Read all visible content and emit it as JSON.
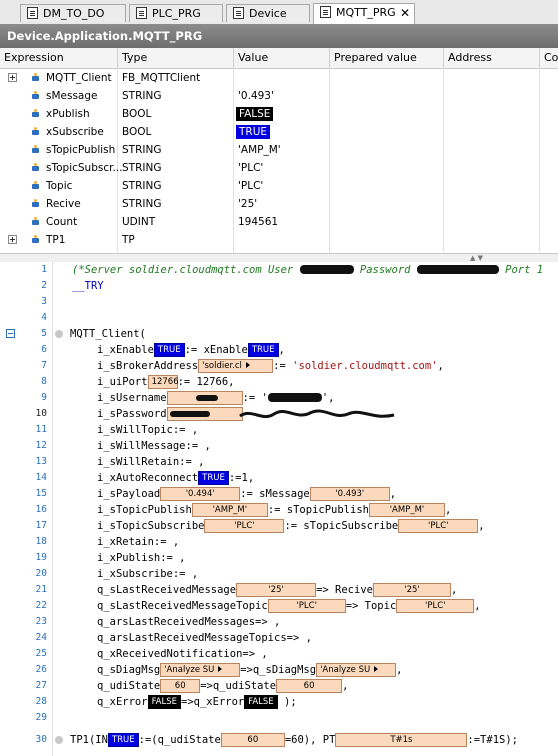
{
  "tabs": [
    {
      "label": "DM_TO_DO"
    },
    {
      "label": "PLC_PRG"
    },
    {
      "label": "Device"
    },
    {
      "label": "MQTT_PRG",
      "close": "✕"
    }
  ],
  "header": {
    "title": "Device.Application.MQTT_PRG"
  },
  "watch": {
    "columns": [
      "Expression",
      "Type",
      "Value",
      "Prepared value",
      "Address",
      "Co"
    ],
    "rows": [
      {
        "expr": "MQTT_Client",
        "type": "FB_MQTTClient",
        "value": ""
      },
      {
        "expr": "sMessage",
        "type": "STRING",
        "value": "'0.493'"
      },
      {
        "expr": "xPublish",
        "type": "BOOL",
        "value": "FALSE"
      },
      {
        "expr": "xSubscribe",
        "type": "BOOL",
        "value": "TRUE"
      },
      {
        "expr": "sTopicPublish",
        "type": "STRING",
        "value": "'AMP_M'"
      },
      {
        "expr": "sTopicSubscr...",
        "type": "STRING",
        "value": "'PLC'"
      },
      {
        "expr": "Topic",
        "type": "STRING",
        "value": "'PLC'"
      },
      {
        "expr": "Recive",
        "type": "STRING",
        "value": "'25'"
      },
      {
        "expr": "Count",
        "type": "UDINT",
        "value": "194561"
      },
      {
        "expr": "TP1",
        "type": "TP",
        "value": ""
      }
    ]
  },
  "code": {
    "line_numbers": [
      "1",
      "2",
      "3",
      "4",
      "5",
      "6",
      "7",
      "8",
      "9",
      "10",
      "11",
      "12",
      "13",
      "14",
      "15",
      "16",
      "17",
      "18",
      "19",
      "20",
      "21",
      "22",
      "23",
      "24",
      "25",
      "26",
      "27",
      "28",
      "29",
      "30"
    ],
    "l1_comment": "(*Server soldier.cloudmqtt.com User ",
    "l1_password": " Password ",
    "l1_port": " Port 1",
    "l2": "__TRY",
    "l5": "MQTT_Client(",
    "l6a": "i_xEnable",
    "l6b": ":= xEnable",
    "l6c": ",",
    "l7a": "i_sBrokerAddress",
    "l7b": ":= ",
    "l7c": "'soldier.cloudmqtt.com'",
    "l7d": ",",
    "l8a": "i_uiPort",
    "l8b": ":= 12766,",
    "l9a": "i_sUsername",
    "l9b": ":= '",
    "l9c": "',",
    "l10a": "i_sPassword",
    "l11": "i_sWillTopic:= ,",
    "l12": "i_sWillMessage:= ,",
    "l13": "i_sWillRetain:= ,",
    "l14a": "i_xAutoReconnect",
    "l14b": ":=1,",
    "l15a": "i_sPayload",
    "l15b": ":= sMessage",
    "l15c": ",",
    "l16a": "i_sTopicPublish",
    "l16b": ":= sTopicPublish",
    "l16c": ",",
    "l17a": "i_sTopicSubscribe",
    "l17b": ":= sTopicSubscribe",
    "l17c": ",",
    "l18": "i_xRetain:= ,",
    "l19": "i_xPublish:= ,",
    "l20": "i_xSubscribe:= ,",
    "l21a": "q_sLastReceivedMessage",
    "l21b": "=> Recive",
    "l21c": ",",
    "l22a": "q_sLastReceivedMessageTopic",
    "l22b": "=> Topic",
    "l22c": ",",
    "l23": "q_arsLastReceivedMessages=> ,",
    "l24": "q_arsLastReceivedMessageTopics=> ,",
    "l25": "q_xReceivedNotification=> ,",
    "l26a": "q_sDiagMsg",
    "l26b": "=>q_sDiagMsg",
    "l26c": ",",
    "l27a": "q_udiState",
    "l27b": "=>q_udiState",
    "l27c": ",",
    "l28a": "q_xError",
    "l28b": "=>q_xError",
    "l28c": " );",
    "l30a": "TP1(IN",
    "l30b": ":=(q_udiState",
    "l30c": "=60), PT",
    "l30d": ":=T#1S);"
  },
  "inline_values": {
    "true": "TRUE",
    "false": "FALSE",
    "broker": "'soldier.cl",
    "port": "12766",
    "payload": "'0.494'",
    "smessage": "'0.493'",
    "topic_pub": "'AMP_M'",
    "topic_pub2": "'AMP_M'",
    "topic_sub": "'PLC'",
    "topic_sub2": "'PLC'",
    "recive": "'25'",
    "recive2": "'25'",
    "topic_in": "'PLC'",
    "topic_in2": "'PLC'",
    "diag": "'Analyze SU",
    "diag2": "'Analyze SU",
    "state": "60",
    "state2": "60",
    "tp_state": "60",
    "pt": "T#1s"
  },
  "colors": {
    "true": "#0000e0",
    "false": "#000000",
    "comment": "#1f7a1f",
    "value_box": "#fbd9bc",
    "header": "#7c7c7c"
  }
}
